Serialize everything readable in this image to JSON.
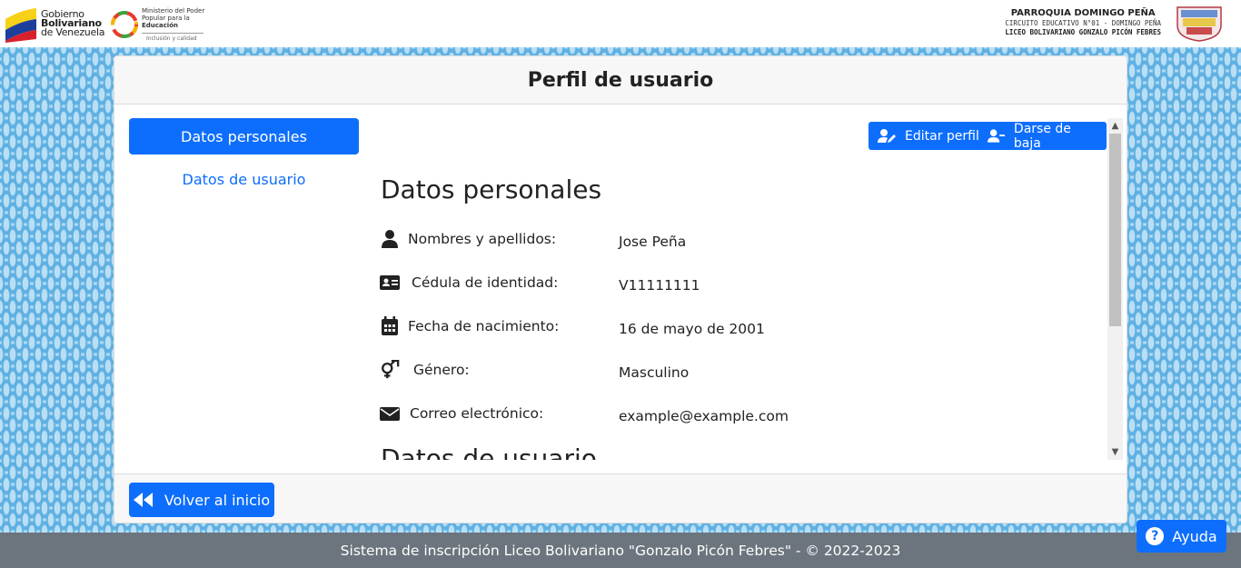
{
  "header": {
    "gov_line1": "Gobierno",
    "gov_line2": "Bolivariano",
    "gov_line3": "de Venezuela",
    "ministry_line1": "Ministerio del Poder",
    "ministry_line2": "Popular para la",
    "ministry_line3": "Educación",
    "ministry_sub": "Inclusión y calidad",
    "school_line1": "PARROQUIA DOMINGO PEÑA",
    "school_line2": "CIRCUITO EDUCATIVO N°01 - DOMINGO PEÑA",
    "school_line3": "LICEO BOLIVARIANO GONZALO PICÓN FEBRES"
  },
  "card": {
    "title": "Perfil de usuario"
  },
  "sidebar": {
    "active": "Datos personales",
    "link": "Datos de usuario"
  },
  "actions": {
    "edit": "Editar perfil",
    "unsubscribe": "Darse de baja"
  },
  "personal": {
    "title": "Datos personales",
    "rows": [
      {
        "icon": "user-icon",
        "label": "Nombres y apellidos:",
        "value": "Jose Peña"
      },
      {
        "icon": "id-card-icon",
        "label": "Cédula de identidad:",
        "value": "V11111111"
      },
      {
        "icon": "calendar-icon",
        "label": "Fecha de nacimiento:",
        "value": "16 de mayo de 2001"
      },
      {
        "icon": "gender-icon",
        "label": "Género:",
        "value": "Masculino"
      },
      {
        "icon": "envelope-icon",
        "label": "Correo electrónico:",
        "value": "example@example.com"
      }
    ]
  },
  "user_section_title": "Datos de usuario",
  "back_button": "Volver al inicio",
  "footer_text": "Sistema de inscripción Liceo Bolivariano \"Gonzalo Picón Febres\" - © 2022-2023",
  "help_button": "Ayuda",
  "colors": {
    "primary": "#0d6efd",
    "footer": "#6c757d"
  }
}
